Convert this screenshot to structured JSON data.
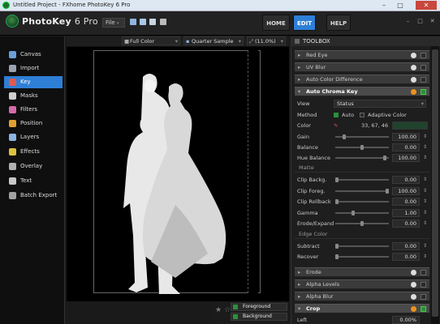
{
  "window": {
    "title": "Untitled Project - FXhome PhotoKey 6 Pro"
  },
  "brand": {
    "name": "PhotoKey",
    "version": "6 Pro"
  },
  "menu": {
    "file": "File"
  },
  "nav": {
    "home": "HOME",
    "edit": "EDIT",
    "help": "HELP"
  },
  "sidebar": {
    "items": [
      {
        "label": "Canvas",
        "icon": "canvas-icon",
        "color": "#6aa0d8"
      },
      {
        "label": "Import",
        "icon": "import-icon",
        "color": "#9aa4b0"
      },
      {
        "label": "Key",
        "icon": "key-icon",
        "color": "#e05a4e"
      },
      {
        "label": "Masks",
        "icon": "masks-icon",
        "color": "#cfcfcf"
      },
      {
        "label": "Filters",
        "icon": "filters-icon",
        "color": "#d56aa8"
      },
      {
        "label": "Position",
        "icon": "position-icon",
        "color": "#e0a030"
      },
      {
        "label": "Layers",
        "icon": "layers-icon",
        "color": "#8ab4e0"
      },
      {
        "label": "Effects",
        "icon": "effects-icon",
        "color": "#e0c040"
      },
      {
        "label": "Overlay",
        "icon": "overlay-icon",
        "color": "#b0b0b0"
      },
      {
        "label": "Text",
        "icon": "text-icon",
        "color": "#c8c8c8"
      },
      {
        "label": "Batch Export",
        "icon": "batch-export-icon",
        "color": "#a0a0a0"
      }
    ],
    "active": "Key"
  },
  "viewer": {
    "color_mode": "Full Color",
    "sample": "Quarter Sample",
    "zoom": "(11.0%)"
  },
  "layers": {
    "foreground": "Foreground",
    "background": "Background"
  },
  "toolbox": {
    "title": "TOOLBOX",
    "sections_top": [
      "Red Eye",
      "UV Blur",
      "Auto Color Difference"
    ],
    "chroma": {
      "title": "Auto Chroma Key",
      "view_label": "View",
      "view_value": "Status",
      "method_label": "Method",
      "method_auto": "Auto",
      "method_adaptive": "Adaptive Color",
      "color_label": "Color",
      "color_value": "33, 67, 46",
      "color_swatch": "#21432e",
      "params": [
        {
          "label": "Gain",
          "value": "100.00",
          "pos": 0.15
        },
        {
          "label": "Balance",
          "value": "0.00",
          "pos": 0.5
        },
        {
          "label": "Hue Balance",
          "value": "100.00",
          "pos": 0.95
        }
      ],
      "matte_title": "Matte",
      "matte": [
        {
          "label": "Clip Backg.",
          "value": "0.00",
          "pos": 0.0
        },
        {
          "label": "Clip Foreg.",
          "value": "100.00",
          "pos": 1.0
        },
        {
          "label": "Clip Rollback",
          "value": "0.00",
          "pos": 0.0
        },
        {
          "label": "Gamma",
          "value": "1.00",
          "pos": 0.33
        },
        {
          "label": "Erode/Expand",
          "value": "0.00",
          "pos": 0.5
        }
      ],
      "edge_title": "Edge Color",
      "edge": [
        {
          "label": "Subtract",
          "value": "0.00",
          "pos": 0.0
        },
        {
          "label": "Recover",
          "value": "0.00",
          "pos": 0.0
        }
      ]
    },
    "sections_bottom": [
      "Erode",
      "Alpha Levels",
      "Alpha Blur"
    ],
    "crop": {
      "title": "Crop",
      "left_label": "Left",
      "left_value": "0.00%"
    }
  }
}
